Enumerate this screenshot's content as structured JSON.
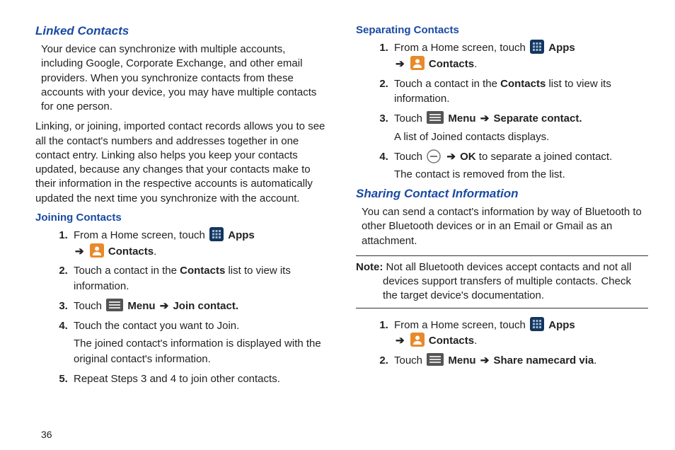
{
  "page_number": "36",
  "col1": {
    "heading1": "Linked Contacts",
    "para1": "Your device can synchronize with multiple accounts, including Google, Corporate Exchange, and other email providers. When you synchronize contacts from these accounts with your device, you may have multiple contacts for one person.",
    "para2": "Linking, or joining, imported contact records allows you to see all the contact's numbers and addresses together in one contact entry. Linking also helps you keep your contacts updated, because any changes that your contacts make to their information in the respective accounts is automatically updated the next time you synchronize with the account.",
    "sub1": "Joining Contacts",
    "steps1": {
      "s1a": "From a Home screen, touch ",
      "s1_apps": "Apps",
      "s1_contacts": "Contacts",
      "s1_period": ".",
      "s2a": "Touch a contact in the ",
      "s2b": "Contacts",
      "s2c": " list to view its information.",
      "s3a": "Touch ",
      "s3_menu": "Menu",
      "s3_join": "Join contact.",
      "s4a": "Touch the contact you want to Join.",
      "s4b": "The joined contact's information is displayed with the original contact's information.",
      "s5": "Repeat Steps 3 and 4 to join other contacts."
    }
  },
  "col2": {
    "sub1": "Separating Contacts",
    "steps1": {
      "s1a": "From a Home screen, touch ",
      "s1_apps": "Apps",
      "s1_contacts": "Contacts",
      "s1_period": ".",
      "s2a": "Touch a contact in the ",
      "s2b": "Contacts",
      "s2c": " list to view its information.",
      "s3a": "Touch ",
      "s3_menu": "Menu",
      "s3_sep": "Separate contact.",
      "s3b": "A list of Joined contacts displays.",
      "s4a": "Touch ",
      "s4_ok": "OK",
      "s4b": " to separate a joined contact.",
      "s4c": "The contact is removed from the list."
    },
    "heading2": "Sharing Contact Information",
    "para1": "You can send a contact's information by way of Bluetooth to other Bluetooth devices or in an Email or Gmail as an attachment.",
    "note_label": "Note:",
    "note_text": " Not all Bluetooth devices accept contacts and not all devices support transfers of multiple contacts. Check the target device's documentation.",
    "steps2": {
      "s1a": "From a Home screen, touch ",
      "s1_apps": "Apps",
      "s1_contacts": "Contacts",
      "s1_period": ".",
      "s2a": "Touch ",
      "s2_menu": "Menu",
      "s2_share": "Share namecard via",
      "s2_period": "."
    }
  },
  "arrow": "➔"
}
